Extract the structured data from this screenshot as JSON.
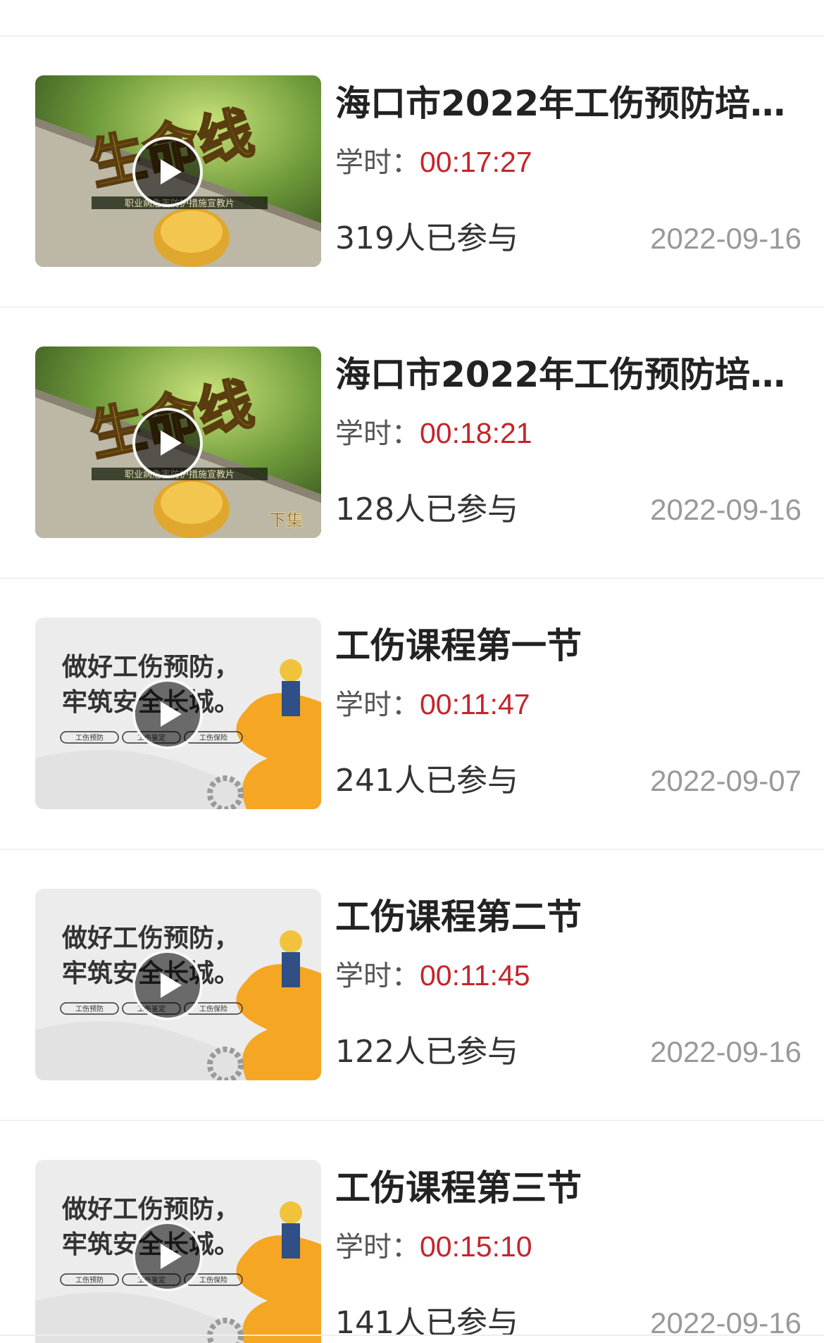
{
  "duration_label": "学时：",
  "courses": [
    {
      "title": "海口市2022年工伤预防培…",
      "duration": "00:17:27",
      "participants": "319人已参与",
      "date": "2022-09-16",
      "thumbnail": {
        "style": "green-lifeline",
        "main_text": "生命线",
        "sub_text": "职业病危害防护措施宣教片",
        "corner_text": ""
      }
    },
    {
      "title": "海口市2022年工伤预防培…",
      "duration": "00:18:21",
      "participants": "128人已参与",
      "date": "2022-09-16",
      "thumbnail": {
        "style": "green-lifeline",
        "main_text": "生命线",
        "sub_text": "职业病危害防护措施宣教片",
        "corner_text": "下集"
      }
    },
    {
      "title": "工伤课程第一节",
      "duration": "00:11:47",
      "participants": "241人已参与",
      "date": "2022-09-07",
      "thumbnail": {
        "style": "grey-worker",
        "line1": "做好工伤预防，",
        "line2": "牢筑安全长城。",
        "tags": [
          "工伤预防",
          "工伤鉴定",
          "工伤保险"
        ]
      }
    },
    {
      "title": "工伤课程第二节",
      "duration": "00:11:45",
      "participants": "122人已参与",
      "date": "2022-09-16",
      "thumbnail": {
        "style": "grey-worker",
        "line1": "做好工伤预防，",
        "line2": "牢筑安全长城。",
        "tags": [
          "工伤预防",
          "工伤鉴定",
          "工伤保险"
        ]
      }
    },
    {
      "title": "工伤课程第三节",
      "duration": "00:15:10",
      "participants": "141人已参与",
      "date": "2022-09-16",
      "thumbnail": {
        "style": "grey-worker",
        "line1": "做好工伤预防，",
        "line2": "牢筑安全长城。",
        "tags": [
          "工伤预防",
          "工伤鉴定",
          "工伤保险"
        ]
      }
    }
  ],
  "colors": {
    "duration": "#c4242b",
    "date": "#999999",
    "title": "#222222"
  }
}
